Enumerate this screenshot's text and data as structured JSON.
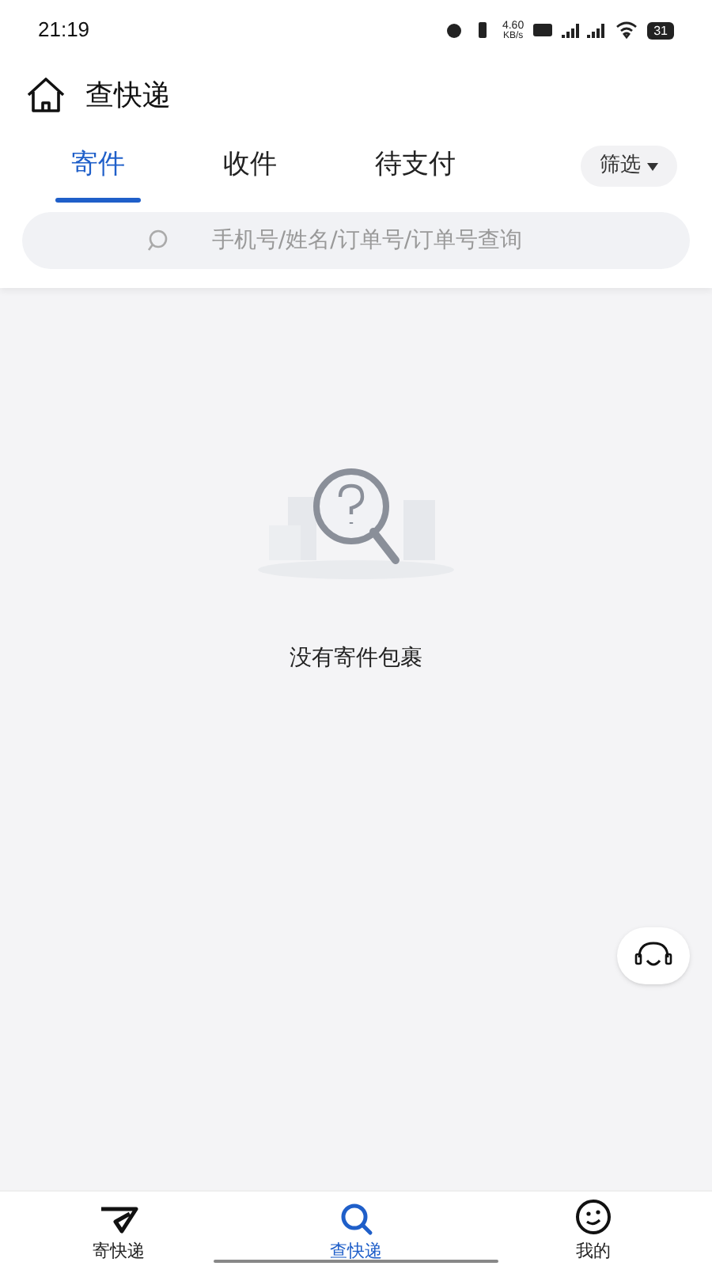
{
  "status_bar": {
    "time": "21:19",
    "speed": "4.60",
    "speed_unit": "KB/s",
    "battery": "31"
  },
  "header": {
    "title": "查快递"
  },
  "tabs": [
    {
      "label": "寄件",
      "selected": true
    },
    {
      "label": "收件",
      "selected": false
    },
    {
      "label": "待支付",
      "selected": false
    }
  ],
  "filter": {
    "label": "筛选"
  },
  "search": {
    "placeholder": "手机号/姓名/订单号/订单号查询"
  },
  "empty_state": {
    "message": "没有寄件包裹"
  },
  "bottom_nav": [
    {
      "kind": "send",
      "label": "寄快递",
      "selected": false
    },
    {
      "kind": "search",
      "label": "查快递",
      "selected": true
    },
    {
      "kind": "profile",
      "label": "我的",
      "selected": false
    }
  ]
}
